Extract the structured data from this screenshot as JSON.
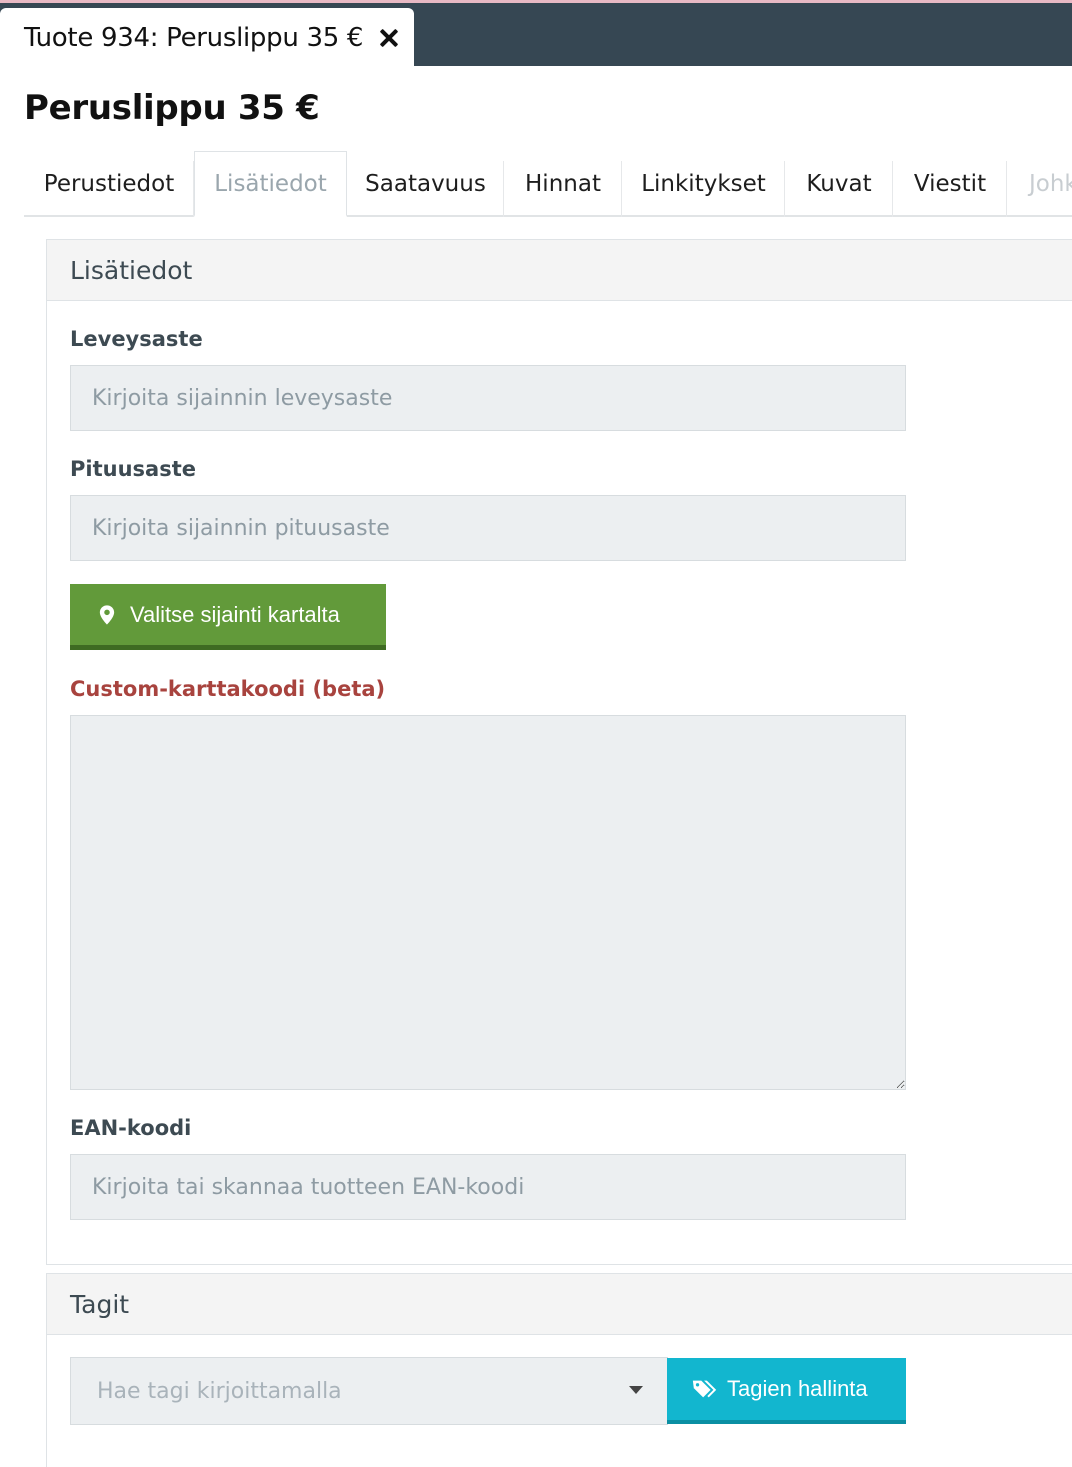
{
  "window": {
    "tab_title": "Tuote 934: Peruslippu 35 €"
  },
  "page": {
    "title": "Peruslippu 35 €"
  },
  "tabs": [
    {
      "label": "Perustiedot",
      "active": false
    },
    {
      "label": "Lisätiedot",
      "active": true
    },
    {
      "label": "Saatavuus",
      "active": false
    },
    {
      "label": "Hinnat",
      "active": false
    },
    {
      "label": "Linkitykset",
      "active": false
    },
    {
      "label": "Kuvat",
      "active": false
    },
    {
      "label": "Viestit",
      "active": false
    },
    {
      "label": "Johk",
      "active": false
    }
  ],
  "details_panel": {
    "title": "Lisätiedot",
    "latitude": {
      "label": "Leveysaste",
      "placeholder": "Kirjoita sijainnin leveysaste",
      "value": ""
    },
    "longitude": {
      "label": "Pituusaste",
      "placeholder": "Kirjoita sijainnin pituusaste",
      "value": ""
    },
    "map_button": {
      "label": "Valitse sijainti kartalta",
      "icon": "map-marker-icon",
      "color": "#629a3a"
    },
    "custom_map_code": {
      "label": "Custom-karttakoodi (beta)",
      "value": "",
      "label_color": "#a8433e"
    },
    "ean": {
      "label": "EAN-koodi",
      "placeholder": "Kirjoita tai skannaa tuotteen EAN-koodi",
      "value": ""
    }
  },
  "tags_panel": {
    "title": "Tagit",
    "search_placeholder": "Hae tagi kirjoittamalla",
    "manage_button": {
      "label": "Tagien hallinta",
      "icon": "tags-icon",
      "color": "#12b6cf"
    }
  }
}
